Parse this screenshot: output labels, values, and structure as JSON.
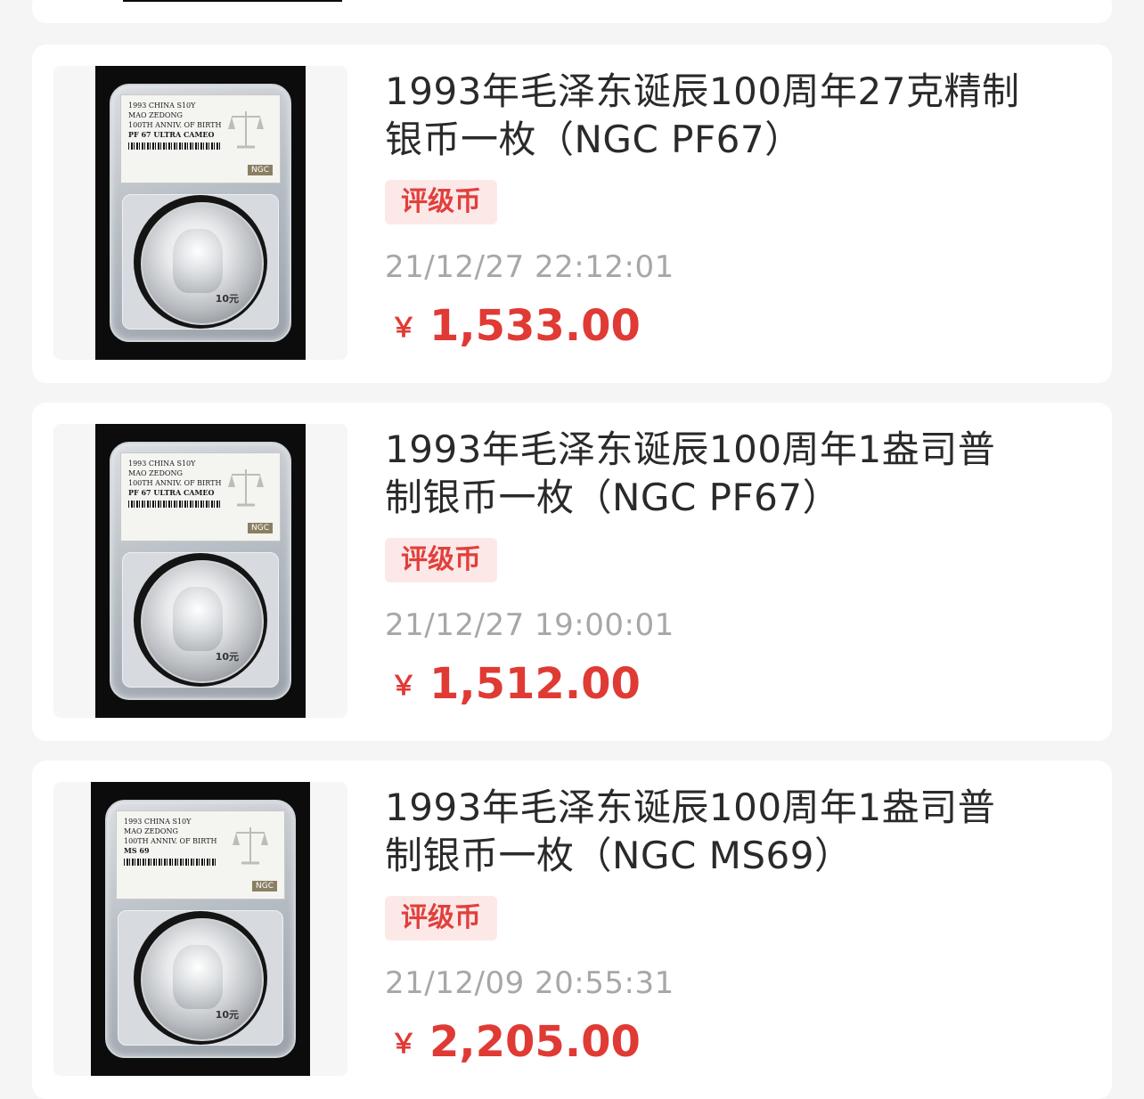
{
  "colors": {
    "page_background": "#f5f5f5",
    "card_background": "#ffffff",
    "tag_background": "#fde8e8",
    "tag_text": "#e0403c",
    "price": "#e03a35",
    "time": "#a7a7a7",
    "title": "#2a2a2a"
  },
  "listings": [
    {
      "title": "1993年毛泽东诞辰100周年27克精制银币一枚（NGC PF67）",
      "title_line1": "1993年毛泽东诞辰100周年27克精制",
      "title_line2": "银币一枚（NGC PF67）",
      "tag": "评级币",
      "time": "21/12/27 22:12:01",
      "currency": "￥",
      "price": "1,533.00",
      "image_icon": "graded-coin-slab-photo",
      "label": {
        "line1": "1993 CHINA S10Y",
        "line2": "MAO ZEDONG",
        "line3": "100TH ANNIV. OF BIRTH",
        "line4": "PF 67 ULTRA CAMEO",
        "logo": "NGC"
      },
      "coin_denom": "10元"
    },
    {
      "title": "1993年毛泽东诞辰100周年1盎司普制银币一枚（NGC PF67）",
      "title_line1": "1993年毛泽东诞辰100周年1盎司普",
      "title_line2": "制银币一枚（NGC PF67）",
      "tag": "评级币",
      "time": "21/12/27 19:00:01",
      "currency": "￥",
      "price": "1,512.00",
      "image_icon": "graded-coin-slab-photo",
      "label": {
        "line1": "1993 CHINA S10Y",
        "line2": "MAO ZEDONG",
        "line3": "100TH ANNIV. OF BIRTH",
        "line4": "PF 67 ULTRA CAMEO",
        "logo": "NGC"
      },
      "coin_denom": "10元"
    },
    {
      "title": "1993年毛泽东诞辰100周年1盎司普制银币一枚（NGC MS69）",
      "title_line1": "1993年毛泽东诞辰100周年1盎司普",
      "title_line2": "制银币一枚（NGC MS69）",
      "tag": "评级币",
      "time": "21/12/09 20:55:31",
      "currency": "￥",
      "price": "2,205.00",
      "image_icon": "graded-coin-slab-photo",
      "label": {
        "line1": "1993 CHINA S10Y",
        "line2": "MAO ZEDONG",
        "line3": "100TH ANNIV. OF BIRTH",
        "line4": "MS 69",
        "logo": "NGC"
      },
      "coin_denom": "10元"
    }
  ]
}
